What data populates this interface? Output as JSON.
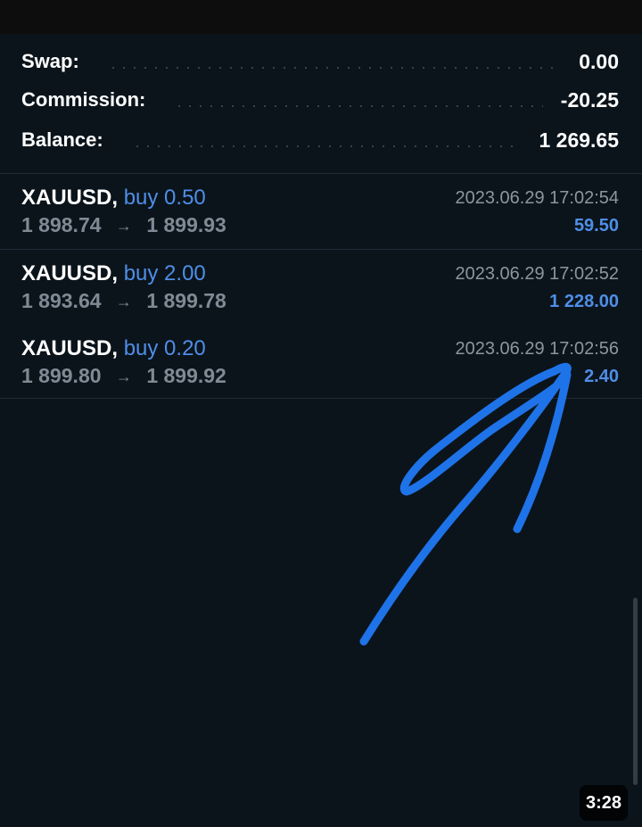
{
  "summary": {
    "swap_label": "Swap:",
    "swap_value": "0.00",
    "commission_label": "Commission:",
    "commission_value": "-20.25",
    "balance_label": "Balance:",
    "balance_value": "1 269.65"
  },
  "trades": [
    {
      "symbol": "XAUUSD,",
      "side": "buy 0.50",
      "open_price": "1 898.74",
      "close_price": "1 899.93",
      "arrow": "→",
      "time": "2023.06.29 17:02:54",
      "profit": "59.50"
    },
    {
      "symbol": "XAUUSD,",
      "side": "buy 2.00",
      "open_price": "1 893.64",
      "close_price": "1 899.78",
      "arrow": "→",
      "time": "2023.06.29 17:02:52",
      "profit": "1 228.00"
    },
    {
      "symbol": "XAUUSD,",
      "side": "buy 0.20",
      "open_price": "1 899.80",
      "close_price": "1 899.92",
      "arrow": "→",
      "time": "2023.06.29 17:02:56",
      "profit": "2.40"
    }
  ],
  "video": {
    "duration": "3:28"
  },
  "colors": {
    "background": "#0b141b",
    "accent_blue": "#4f8ee8",
    "annotation_blue": "#1f73e8"
  }
}
